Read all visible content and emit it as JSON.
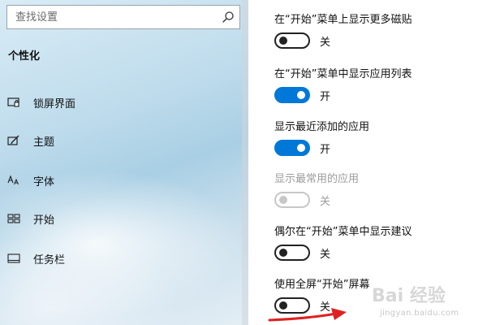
{
  "search": {
    "placeholder": "查找设置"
  },
  "sidebar": {
    "section_title": "个性化",
    "items": [
      {
        "label": "锁屏界面",
        "icon": "lock-screen-icon"
      },
      {
        "label": "主题",
        "icon": "theme-brush-icon"
      },
      {
        "label": "字体",
        "icon": "font-icon"
      },
      {
        "label": "开始",
        "icon": "start-grid-icon"
      },
      {
        "label": "任务栏",
        "icon": "taskbar-icon"
      }
    ]
  },
  "settings": [
    {
      "label": "在“开始”菜单上显示更多磁贴",
      "state": "关",
      "on": false,
      "disabled": false
    },
    {
      "label": "在“开始”菜单中显示应用列表",
      "state": "开",
      "on": true,
      "disabled": false
    },
    {
      "label": "显示最近添加的应用",
      "state": "开",
      "on": true,
      "disabled": false
    },
    {
      "label": "显示最常用的应用",
      "state": "关",
      "on": false,
      "disabled": true
    },
    {
      "label": "偶尔在“开始”菜单中显示建议",
      "state": "关",
      "on": false,
      "disabled": false
    },
    {
      "label": "使用全屏“开始”屏幕",
      "state": "关",
      "on": false,
      "disabled": false
    }
  ],
  "colors": {
    "accent": "#0078d7",
    "arrow": "#e02020",
    "disabled": "#c7c7c7"
  },
  "watermark": {
    "brand": "Bai 经验",
    "url": "jingyan.baidu.com"
  }
}
